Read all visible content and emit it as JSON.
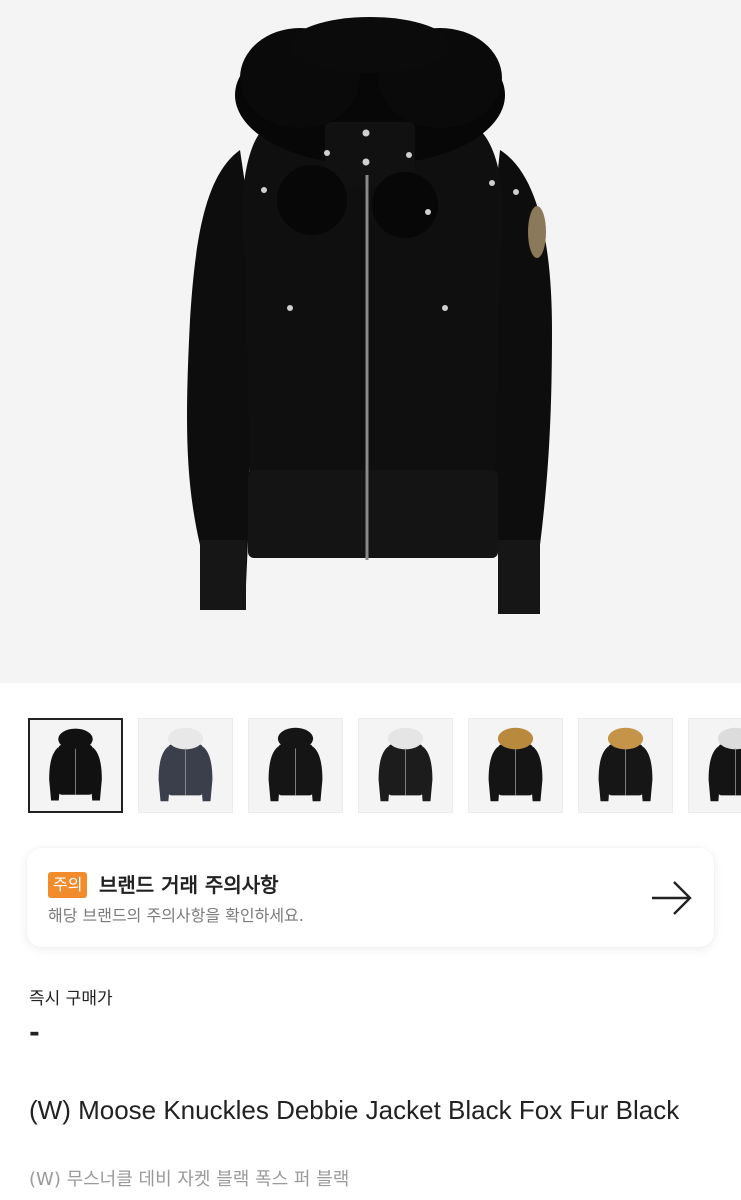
{
  "gallery": {
    "main_image_alt": "black bomber jacket with black fox fur hood",
    "thumbnails": [
      {
        "label": "black jacket black fur",
        "selected": true,
        "body": "#111111",
        "fur": "#111111"
      },
      {
        "label": "navy jacket white fur",
        "selected": false,
        "body": "#3a3f4b",
        "fur": "#e8e8e8"
      },
      {
        "label": "black jacket black fur alt",
        "selected": false,
        "body": "#151515",
        "fur": "#151515"
      },
      {
        "label": "black jacket white fur",
        "selected": false,
        "body": "#1c1c1c",
        "fur": "#e5e5e5"
      },
      {
        "label": "black jacket gold fur",
        "selected": false,
        "body": "#141414",
        "fur": "#b98a3e"
      },
      {
        "label": "black jacket gold fur alt",
        "selected": false,
        "body": "#161616",
        "fur": "#c59448"
      },
      {
        "label": "black jacket partial",
        "selected": false,
        "body": "#141414",
        "fur": "#dcdcdc"
      }
    ]
  },
  "notice": {
    "badge": "주의",
    "title": "브랜드 거래 주의사항",
    "subtitle": "해당 브랜드의 주의사항을 확인하세요.",
    "badge_color": "#f28b2c"
  },
  "price": {
    "label": "즉시 구매가",
    "value": "-"
  },
  "product": {
    "name_en": "(W) Moose Knuckles Debbie Jacket Black Fox Fur Black",
    "name_ko": "(W) 무스너클 데비 자켓 블랙 폭스 퍼 블랙"
  }
}
